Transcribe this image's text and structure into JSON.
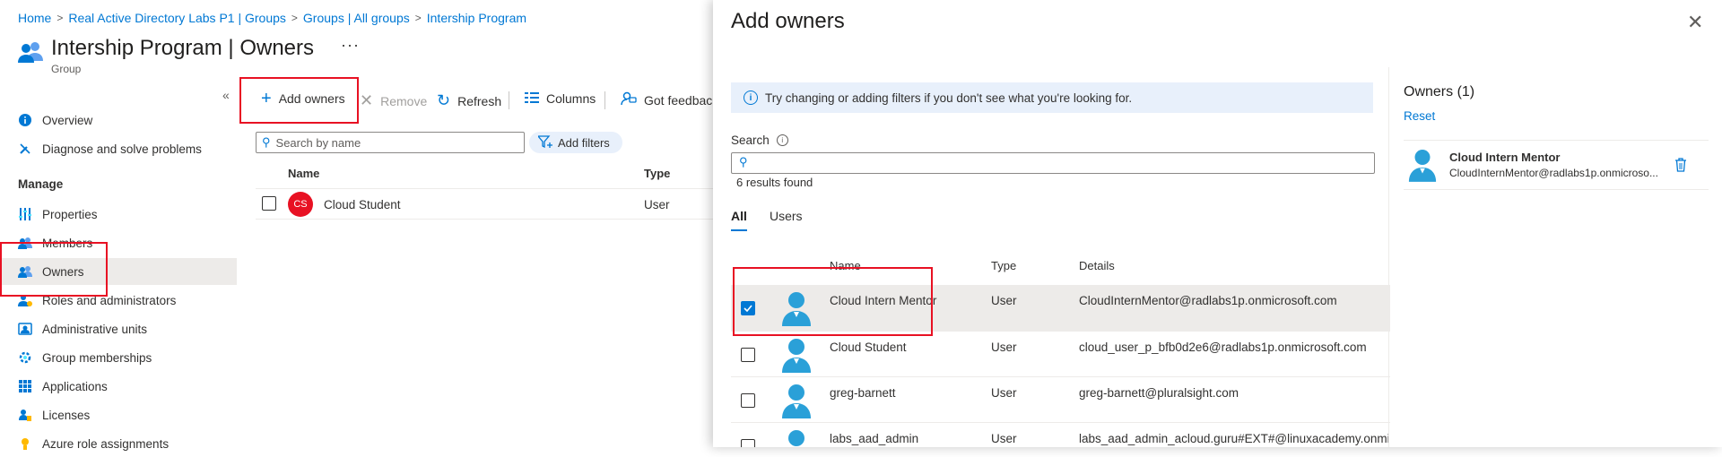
{
  "breadcrumb": [
    "Home",
    "Real Active Directory Labs P1 | Groups",
    "Groups | All groups",
    "Intership Program"
  ],
  "page": {
    "title": "Intership Program | Owners",
    "subtitle": "Group",
    "more": "···"
  },
  "nav": {
    "items_top": [
      {
        "label": "Overview",
        "icon": "info-icon"
      },
      {
        "label": "Diagnose and solve problems",
        "icon": "wrench-icon"
      }
    ],
    "section": "Manage",
    "items": [
      {
        "label": "Properties",
        "icon": "properties-icon"
      },
      {
        "label": "Members",
        "icon": "members-icon"
      },
      {
        "label": "Owners",
        "icon": "owners-icon",
        "active": true
      },
      {
        "label": "Roles and administrators",
        "icon": "roles-icon"
      },
      {
        "label": "Administrative units",
        "icon": "admin-units-icon"
      },
      {
        "label": "Group memberships",
        "icon": "group-memberships-icon"
      },
      {
        "label": "Applications",
        "icon": "applications-icon"
      },
      {
        "label": "Licenses",
        "icon": "licenses-icon"
      },
      {
        "label": "Azure role assignments",
        "icon": "role-assignments-icon"
      }
    ]
  },
  "toolbar": {
    "add_owners": "Add owners",
    "remove": "Remove",
    "refresh": "Refresh",
    "columns": "Columns",
    "feedback": "Got feedback"
  },
  "filters": {
    "search_placeholder": "Search by name",
    "add_filters": "Add filters"
  },
  "grid": {
    "headers": [
      "Name",
      "Type"
    ],
    "rows": [
      {
        "initials": "CS",
        "name": "Cloud Student",
        "type": "User"
      }
    ]
  },
  "panel": {
    "title": "Add owners",
    "info": "Try changing or adding filters if you don't see what you're looking for.",
    "search_label": "Search",
    "results": "6 results found",
    "tabs": [
      "All",
      "Users"
    ],
    "headers": [
      "Name",
      "Type",
      "Details"
    ],
    "rows": [
      {
        "name": "Cloud Intern Mentor",
        "type": "User",
        "details": "CloudInternMentor@radlabs1p.onmicrosoft.com",
        "checked": true
      },
      {
        "name": "Cloud Student",
        "type": "User",
        "details": "cloud_user_p_bfb0d2e6@radlabs1p.onmicrosoft.com",
        "checked": false
      },
      {
        "name": "greg-barnett",
        "type": "User",
        "details": "greg-barnett@pluralsight.com",
        "checked": false
      },
      {
        "name": "labs_aad_admin",
        "type": "User",
        "details": "labs_aad_admin_acloud.guru#EXT#@linuxacademy.onmicrosoft.com",
        "checked": false
      }
    ],
    "owners_title": "Owners (1)",
    "reset": "Reset",
    "selected": {
      "name": "Cloud Intern Mentor",
      "email": "CloudInternMentor@radlabs1p.onmicroso..."
    }
  },
  "colors": {
    "accent": "#0078d4",
    "highlight": "#e81123",
    "avatar_cs": "#e81123",
    "person": "#2aa0d8"
  }
}
